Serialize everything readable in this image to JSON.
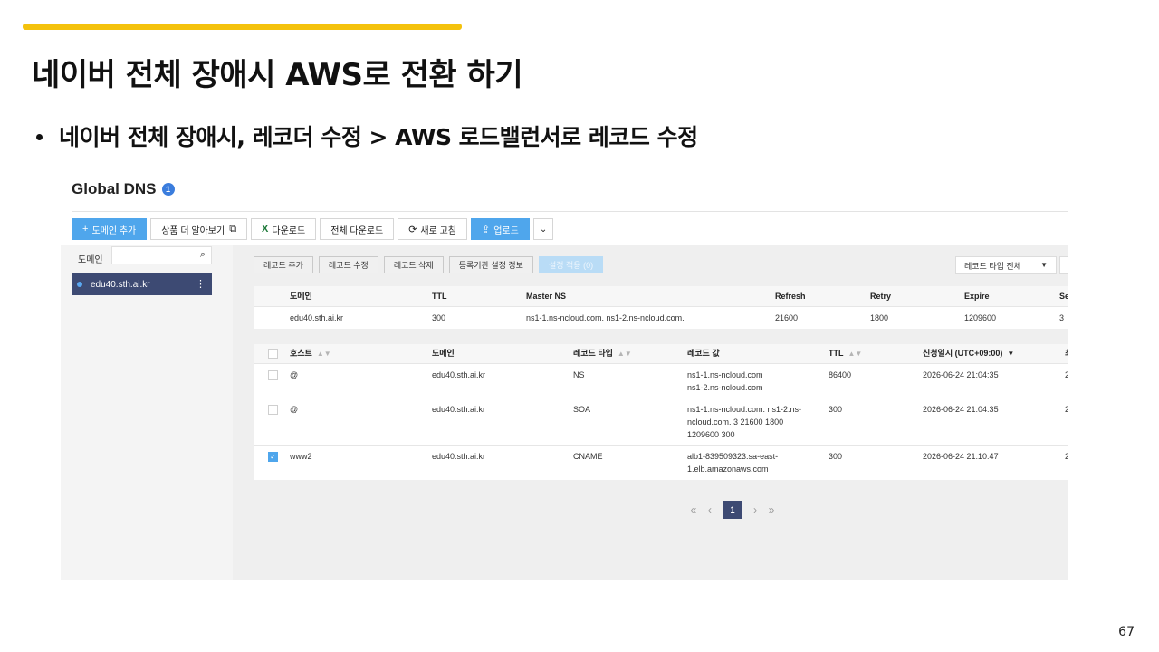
{
  "slide": {
    "title": "네이버 전체 장애시 AWS로 전환 하기",
    "bullet": "네이버 전체 장애시,  레코더 수정 > AWS 로드밸런서로 레코드 수정",
    "page_number": "67"
  },
  "console": {
    "title": "Global DNS",
    "info_badge": "1",
    "toolbar": {
      "add_domain": "도메인 추가",
      "learn_more": "상품 더 알아보기",
      "download": "다운로드",
      "download_all": "전체 다운로드",
      "refresh": "새로 고침",
      "upload": "업로드"
    },
    "sidebar": {
      "label": "도메인",
      "search_placeholder": "",
      "domain": "edu40.sth.ai.kr"
    },
    "actions": {
      "add_record": "레코드 추가",
      "edit_record": "레코드 수정",
      "delete_record": "레코드 삭제",
      "registrar_info": "등록기관 설정 정보",
      "apply_settings": "설정 적용 (0)"
    },
    "record_type_filter": "레코드 타입 전체",
    "domain_table": {
      "headers": [
        "도메인",
        "TTL",
        "Master NS",
        "Refresh",
        "Retry",
        "Expire",
        "Se"
      ],
      "row": [
        "edu40.sth.ai.kr",
        "300",
        "ns1-1.ns-ncloud.com. ns1-2.ns-ncloud.com.",
        "21600",
        "1800",
        "1209600",
        "3"
      ]
    },
    "record_table": {
      "headers": [
        "호스트",
        "도메인",
        "레코드 타입",
        "레코드 값",
        "TTL",
        "신청일시 (UTC+09:00)",
        "최"
      ],
      "rows": [
        {
          "checked": false,
          "host": "@",
          "domain": "edu40.sth.ai.kr",
          "type": "NS",
          "value_1": "ns1-1.ns-ncloud.com",
          "value_2": "ns1-2.ns-ncloud.com",
          "value_3": "",
          "ttl": "86400",
          "created": "2026-06-24 21:04:35",
          "last": "2"
        },
        {
          "checked": false,
          "host": "@",
          "domain": "edu40.sth.ai.kr",
          "type": "SOA",
          "value_1": "ns1-1.ns-ncloud.com. ns1-2.ns-",
          "value_2": "ncloud.com. 3 21600 1800",
          "value_3": "1209600 300",
          "ttl": "300",
          "created": "2026-06-24 21:04:35",
          "last": "2"
        },
        {
          "checked": true,
          "host": "www2",
          "domain": "edu40.sth.ai.kr",
          "type": "CNAME",
          "value_1": "alb1-839509323.sa-east-",
          "value_2": "1.elb.amazonaws.com",
          "value_3": "",
          "ttl": "300",
          "created": "2026-06-24 21:10:47",
          "last": "2"
        }
      ]
    },
    "pagination": {
      "current": "1"
    }
  }
}
